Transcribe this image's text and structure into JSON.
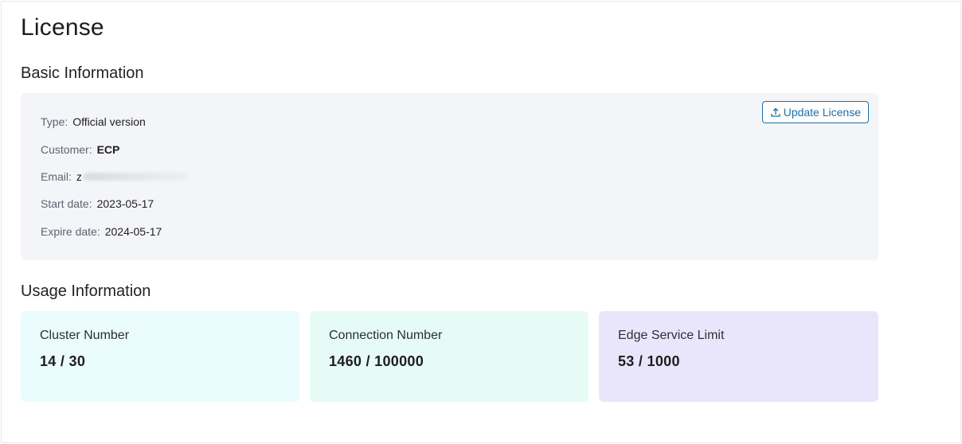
{
  "page": {
    "title": "License"
  },
  "basic": {
    "section_title": "Basic Information",
    "update_button_label": "Update License",
    "update_icon": "upload-icon",
    "separator": ":",
    "rows": {
      "type": {
        "label": "Type",
        "value": "Official version"
      },
      "customer": {
        "label": "Customer",
        "value": "ECP"
      },
      "email": {
        "label": "Email",
        "value": "z"
      },
      "start_date": {
        "label": "Start date",
        "value": "2023-05-17"
      },
      "expire_date": {
        "label": "Expire date",
        "value": "2024-05-17"
      }
    }
  },
  "usage": {
    "section_title": "Usage Information",
    "cards": {
      "cluster": {
        "label": "Cluster Number",
        "value": "14 / 30",
        "bg_color": "#eafcfd"
      },
      "connection": {
        "label": "Connection Number",
        "value": "1460 / 100000",
        "bg_color": "#e7fbf6"
      },
      "edge": {
        "label": "Edge Service Limit",
        "value": "53 / 1000",
        "bg_color": "#e9e6fb"
      }
    }
  },
  "colors": {
    "accent": "#1a6fa8",
    "info_card_bg": "#f4f5f9"
  }
}
